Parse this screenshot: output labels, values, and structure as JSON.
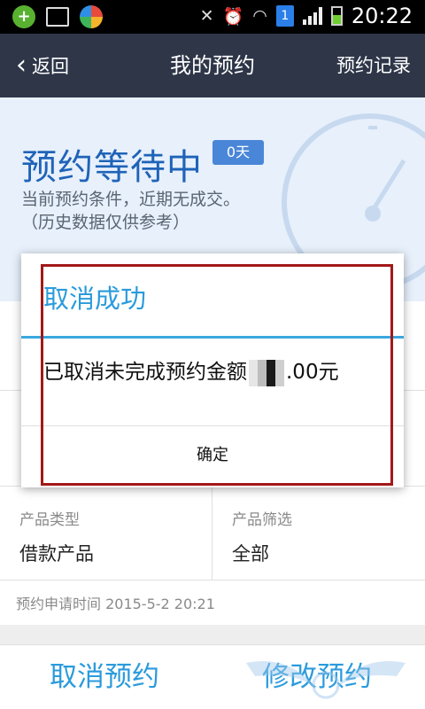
{
  "status_bar": {
    "time": "20:22",
    "sim_badge": "1",
    "left_icons": [
      "app-plus-icon",
      "gallery-icon",
      "market-icon"
    ],
    "right_icons": [
      "mute-icon",
      "alarm-icon",
      "wifi-icon",
      "signal-icon",
      "battery-icon"
    ]
  },
  "app_bar": {
    "back_label": "返回",
    "title": "我的预约",
    "records_label": "预约记录"
  },
  "hero": {
    "status_title": "预约等待中",
    "days_badge": "0天",
    "line1": "当前预约条件，近期无成交。",
    "line2": "（历史数据仅供参考）"
  },
  "details": {
    "product_type_label": "产品类型",
    "product_type_value": "借款产品",
    "product_filter_label": "产品筛选",
    "product_filter_value": "全部",
    "apply_time": "预约申请时间 2015-5-2 20:21"
  },
  "bottom_bar": {
    "cancel_label": "取消预约",
    "modify_label": "修改预约"
  },
  "dialog": {
    "title": "取消成功",
    "message_prefix": "已取消未完成预约金额",
    "message_suffix": ".00元",
    "ok_label": "确定"
  },
  "colors": {
    "app_bar": "#2e3648",
    "accent_blue": "#2b9bdc",
    "hero_title": "#1f63b8",
    "highlight_frame": "#a31818"
  }
}
